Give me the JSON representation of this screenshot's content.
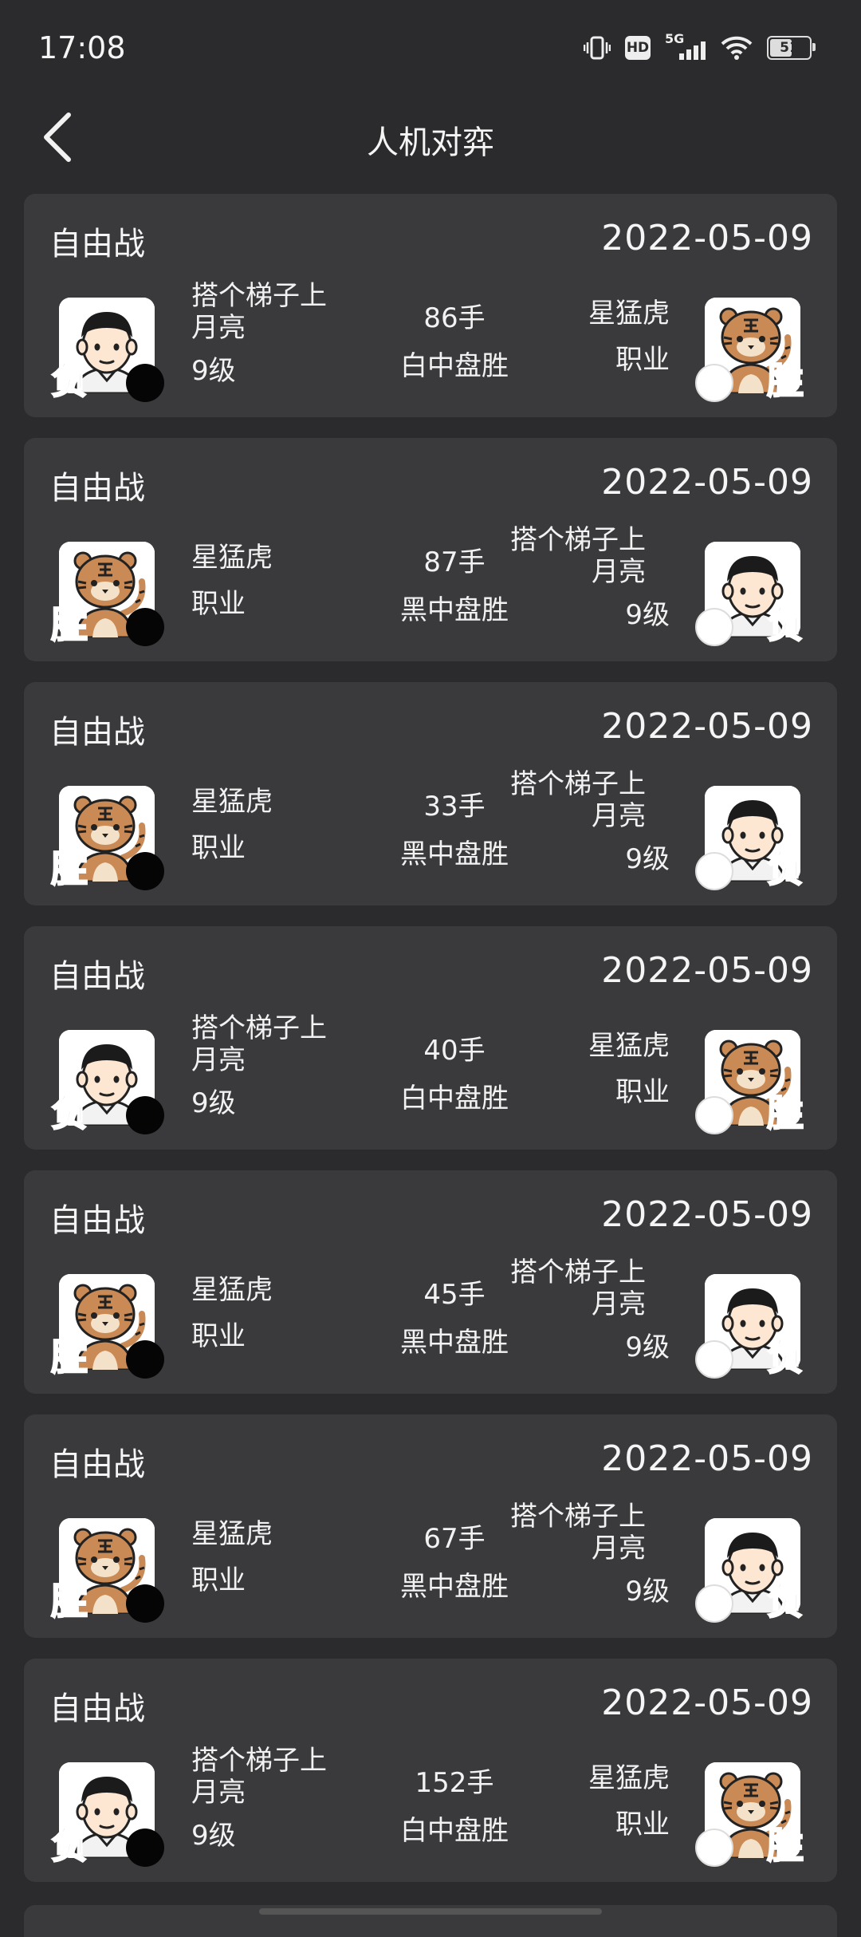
{
  "status_bar": {
    "time": "17:08",
    "network": "5G",
    "hd_label": "HD",
    "battery": "51"
  },
  "nav": {
    "title": "人机对弈"
  },
  "games": [
    {
      "type": "自由战",
      "date": "2022-05-09",
      "left": {
        "avatar": "boy",
        "stone": "black",
        "result": "负",
        "name": "搭个梯子上月亮",
        "rank": "9级"
      },
      "moves": "86手",
      "result": "白中盘胜",
      "right": {
        "avatar": "tiger",
        "stone": "white",
        "result": "胜",
        "name": "星猛虎",
        "rank": "职业"
      }
    },
    {
      "type": "自由战",
      "date": "2022-05-09",
      "left": {
        "avatar": "tiger",
        "stone": "black",
        "result": "胜",
        "name": "星猛虎",
        "rank": "职业"
      },
      "moves": "87手",
      "result": "黑中盘胜",
      "right": {
        "avatar": "boy",
        "stone": "white",
        "result": "负",
        "name": "搭个梯子上月亮",
        "rank": "9级"
      }
    },
    {
      "type": "自由战",
      "date": "2022-05-09",
      "left": {
        "avatar": "tiger",
        "stone": "black",
        "result": "胜",
        "name": "星猛虎",
        "rank": "职业"
      },
      "moves": "33手",
      "result": "黑中盘胜",
      "right": {
        "avatar": "boy",
        "stone": "white",
        "result": "负",
        "name": "搭个梯子上月亮",
        "rank": "9级"
      }
    },
    {
      "type": "自由战",
      "date": "2022-05-09",
      "left": {
        "avatar": "boy",
        "stone": "black",
        "result": "负",
        "name": "搭个梯子上月亮",
        "rank": "9级"
      },
      "moves": "40手",
      "result": "白中盘胜",
      "right": {
        "avatar": "tiger",
        "stone": "white",
        "result": "胜",
        "name": "星猛虎",
        "rank": "职业"
      }
    },
    {
      "type": "自由战",
      "date": "2022-05-09",
      "left": {
        "avatar": "tiger",
        "stone": "black",
        "result": "胜",
        "name": "星猛虎",
        "rank": "职业"
      },
      "moves": "45手",
      "result": "黑中盘胜",
      "right": {
        "avatar": "boy",
        "stone": "white",
        "result": "负",
        "name": "搭个梯子上月亮",
        "rank": "9级"
      }
    },
    {
      "type": "自由战",
      "date": "2022-05-09",
      "left": {
        "avatar": "tiger",
        "stone": "black",
        "result": "胜",
        "name": "星猛虎",
        "rank": "职业"
      },
      "moves": "67手",
      "result": "黑中盘胜",
      "right": {
        "avatar": "boy",
        "stone": "white",
        "result": "负",
        "name": "搭个梯子上月亮",
        "rank": "9级"
      }
    },
    {
      "type": "自由战",
      "date": "2022-05-09",
      "left": {
        "avatar": "boy",
        "stone": "black",
        "result": "负",
        "name": "搭个梯子上月亮",
        "rank": "9级"
      },
      "moves": "152手",
      "result": "白中盘胜",
      "right": {
        "avatar": "tiger",
        "stone": "white",
        "result": "胜",
        "name": "星猛虎",
        "rank": "职业"
      }
    }
  ],
  "colors": {
    "background": "#2b2b2d",
    "card": "#3a3a3d",
    "win": "#f6b335",
    "lose": "#9b9b9b"
  }
}
